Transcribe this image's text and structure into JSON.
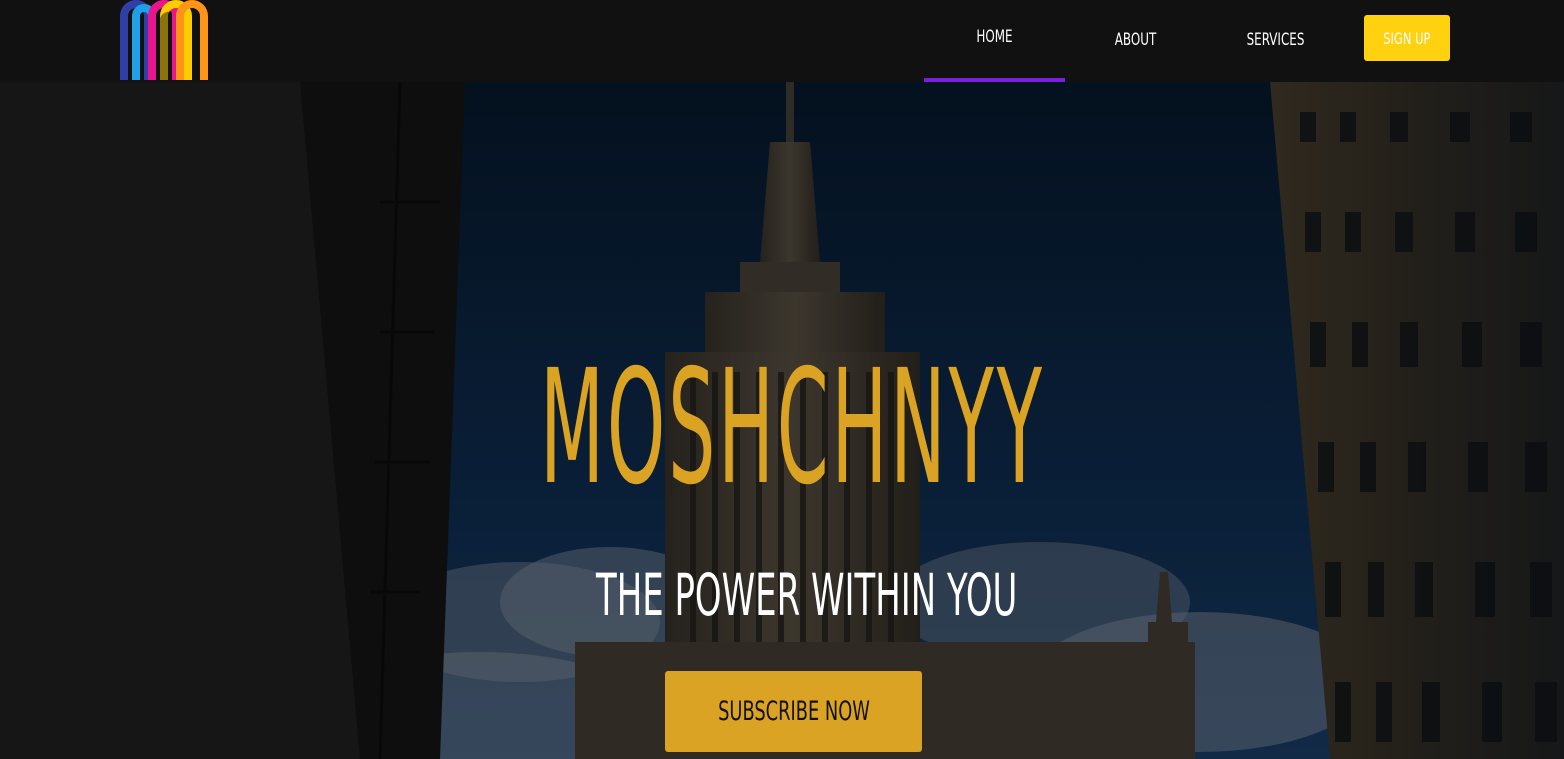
{
  "brand": {
    "logo_icon": "rainbow-arch-m-logo",
    "logo_colors": [
      "#2f3fa6",
      "#1ea0e8",
      "#e8168c",
      "#ffcc00",
      "#ff9416"
    ]
  },
  "nav": {
    "items": [
      {
        "label": "HOME",
        "active": true
      },
      {
        "label": "ABOUT",
        "active": false
      },
      {
        "label": "SERVICES",
        "active": false
      }
    ],
    "signup_label": "SIGN UP",
    "active_color": "#7a1fe0",
    "signup_color": "#ffd10f"
  },
  "hero": {
    "title": "MOSHCHNYY",
    "subtitle": "THE POWER WITHIN YOU",
    "cta_label": "SUBSCRIBE NOW",
    "accent_color": "#dba323",
    "background_image": "city-skyscraper-photo"
  }
}
